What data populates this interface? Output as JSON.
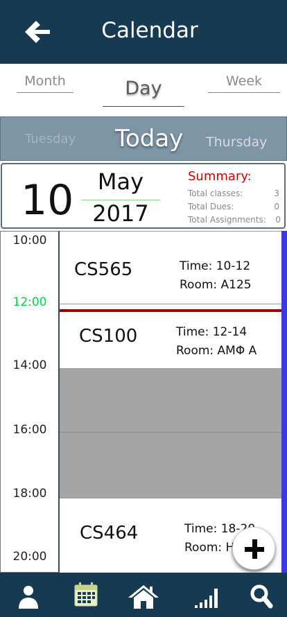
{
  "header": {
    "title": "Calendar",
    "back_icon": "arrow-left-icon",
    "color": "#173a53"
  },
  "view_modes": {
    "month": "Month",
    "day": "Day",
    "week": "Week",
    "selected": "Day"
  },
  "day_switcher": {
    "previous": "Tuesday",
    "current": "Today",
    "next": "Thursday"
  },
  "date_card": {
    "day": "10",
    "month": "May",
    "year": "2017"
  },
  "summary": {
    "title": "Summary:",
    "rows": [
      {
        "label": "Total classes:",
        "value": "3"
      },
      {
        "label": "Total Dues:",
        "value": "0"
      },
      {
        "label": "Total Assignments:",
        "value": "0"
      }
    ]
  },
  "times": [
    "10:00",
    "12:00",
    "14:00",
    "16:00",
    "18:00",
    "20:00"
  ],
  "current_time_label": "12:00",
  "events": [
    {
      "course": "CS565",
      "time": "Time: 10-12",
      "room": "Room: A125"
    },
    {
      "course": "CS100",
      "time": "Time: 12-14",
      "room": "Room: ΑΜΦ Α"
    },
    {
      "course": "CS464",
      "time": "Time: 18-20",
      "room": "Room: H"
    }
  ],
  "fab": {
    "icon": "plus-icon"
  },
  "bottom_nav": [
    "user-icon",
    "calendar-icon",
    "home-icon",
    "signal-bars-icon",
    "search-icon"
  ],
  "colors": {
    "accent": "#3a3ae0",
    "now_line": "#9b0000",
    "current_time": "#00d24a"
  }
}
